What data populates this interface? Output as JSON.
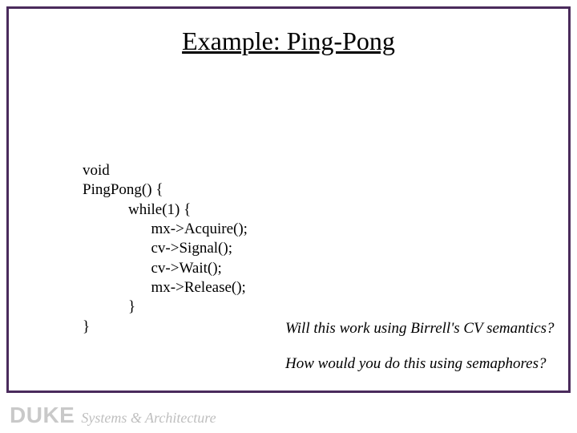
{
  "title": "Example: Ping-Pong",
  "code": {
    "l1": "void",
    "l2": "PingPong() {",
    "l3": "            while(1) {",
    "l4": "                  mx->Acquire();",
    "l5": "                  cv->Signal();",
    "l6": "                  cv->Wait();",
    "l7": "                  mx->Release();",
    "l8": "            }",
    "l9": "}"
  },
  "questions": {
    "q1": "Will this work using Birrell's CV semantics?",
    "q2": "How would you do this using semaphores?"
  },
  "footer": {
    "org": "DUKE",
    "dept": "Systems & Architecture"
  }
}
